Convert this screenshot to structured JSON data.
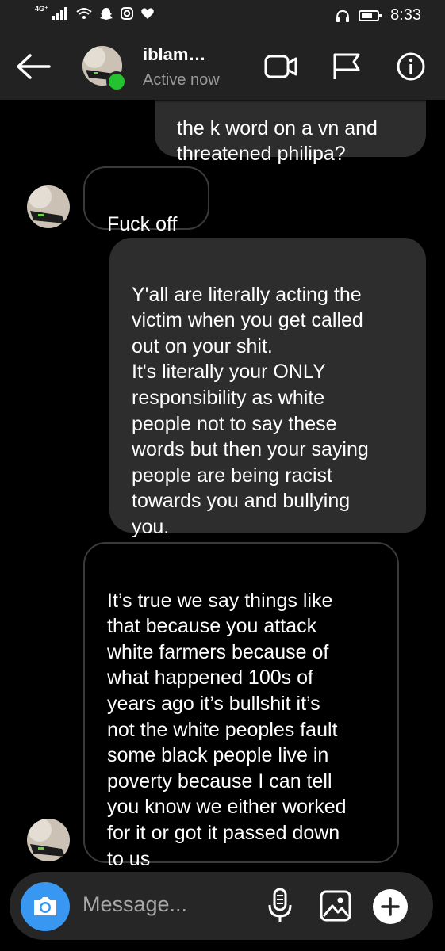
{
  "status_bar": {
    "network": "4G⁺",
    "time": "8:33"
  },
  "header": {
    "contact_name": "iblam…",
    "status": "Active now"
  },
  "messages": [
    {
      "type": "sent",
      "text": "the k word on a vn and\nthreatened philipa?"
    },
    {
      "type": "received",
      "text": "Fuck off"
    },
    {
      "type": "sent",
      "text": "Y'all are literally acting the\nvictim when you get called\nout on your shit.\nIt's literally your ONLY\nresponsibility as white\npeople not to say these\nwords but then your saying\npeople are being racist\ntowards you and bullying\nyou."
    },
    {
      "type": "received",
      "text": "It’s true we say things like\nthat because you attack\nwhite farmers because of\nwhat happened 100s of\nyears ago it’s bullshit it’s\nnot the white peoples fault\nsome black people live in\npoverty because I can tell\nyou know we either worked\nfor it or got it passed down\nto us"
    }
  ],
  "composer": {
    "placeholder": "Message..."
  },
  "colors": {
    "accent": "#3897f0",
    "online": "#24c130",
    "sent_bubble": "#2d2d2d"
  },
  "icons": [
    "back-arrow-icon",
    "video-call-icon",
    "flag-icon",
    "info-icon",
    "camera-icon",
    "microphone-icon",
    "gallery-icon",
    "plus-icon"
  ]
}
